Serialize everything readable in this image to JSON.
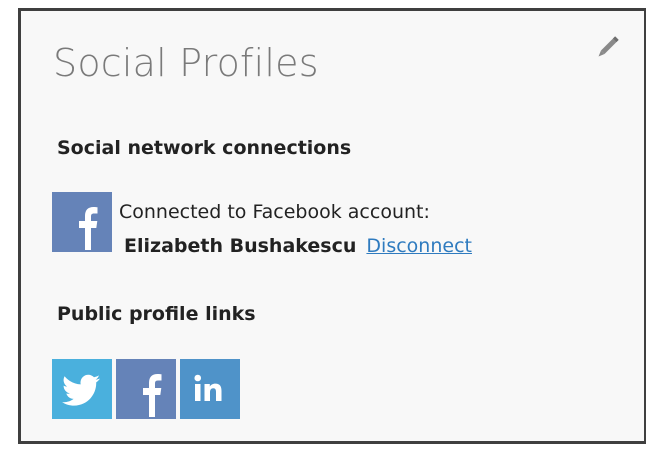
{
  "card": {
    "title": "Social Profiles",
    "edit_icon": "pencil-icon"
  },
  "connections": {
    "heading": "Social network connections",
    "facebook": {
      "icon": "facebook-icon",
      "status_text": "Connected to Facebook account:",
      "account_name": "Elizabeth Bushakescu",
      "disconnect_label": "Disconnect"
    }
  },
  "public_links": {
    "heading": "Public profile links",
    "items": [
      {
        "icon": "twitter-icon",
        "color": "#4ab0dd"
      },
      {
        "icon": "facebook-icon",
        "color": "#6583b8"
      },
      {
        "icon": "linkedin-icon",
        "color": "#4f93c9"
      }
    ]
  },
  "colors": {
    "link": "#2f7bbf",
    "title": "#7a7a7a",
    "facebook": "#6583b8"
  }
}
